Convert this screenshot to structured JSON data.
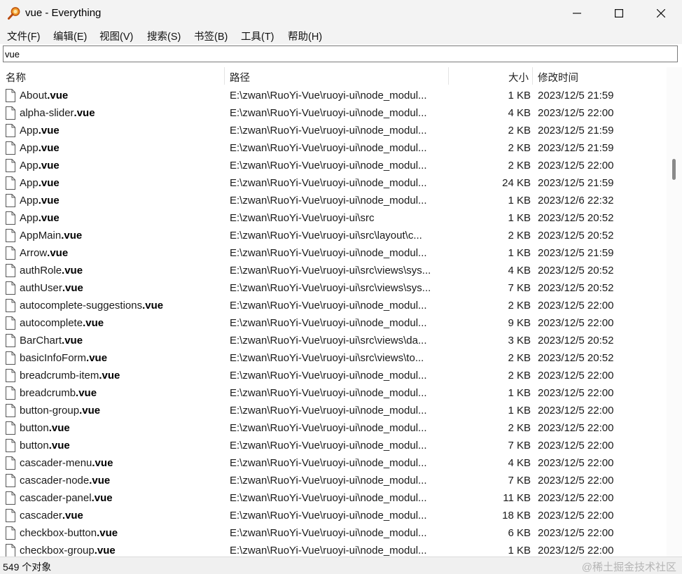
{
  "window": {
    "title": "vue - Everything",
    "minimize_icon": "minimize-icon",
    "maximize_icon": "maximize-icon",
    "close_icon": "close-icon"
  },
  "menu": [
    "文件(F)",
    "编辑(E)",
    "视图(V)",
    "搜索(S)",
    "书签(B)",
    "工具(T)",
    "帮助(H)"
  ],
  "search": {
    "value": "vue",
    "placeholder": ""
  },
  "columns": {
    "name": "名称",
    "path": "路径",
    "size": "大小",
    "modified": "修改时间"
  },
  "files": [
    {
      "base": "About",
      "ext": ".vue",
      "path": "E:\\zwan\\RuoYi-Vue\\ruoyi-ui\\node_modul...",
      "size": "1 KB",
      "date": "2023/12/5 21:59"
    },
    {
      "base": "alpha-slider",
      "ext": ".vue",
      "path": "E:\\zwan\\RuoYi-Vue\\ruoyi-ui\\node_modul...",
      "size": "4 KB",
      "date": "2023/12/5 22:00"
    },
    {
      "base": "App",
      "ext": ".vue",
      "path": "E:\\zwan\\RuoYi-Vue\\ruoyi-ui\\node_modul...",
      "size": "2 KB",
      "date": "2023/12/5 21:59"
    },
    {
      "base": "App",
      "ext": ".vue",
      "path": "E:\\zwan\\RuoYi-Vue\\ruoyi-ui\\node_modul...",
      "size": "2 KB",
      "date": "2023/12/5 21:59"
    },
    {
      "base": "App",
      "ext": ".vue",
      "path": "E:\\zwan\\RuoYi-Vue\\ruoyi-ui\\node_modul...",
      "size": "2 KB",
      "date": "2023/12/5 22:00"
    },
    {
      "base": "App",
      "ext": ".vue",
      "path": "E:\\zwan\\RuoYi-Vue\\ruoyi-ui\\node_modul...",
      "size": "24 KB",
      "date": "2023/12/5 21:59"
    },
    {
      "base": "App",
      "ext": ".vue",
      "path": "E:\\zwan\\RuoYi-Vue\\ruoyi-ui\\node_modul...",
      "size": "1 KB",
      "date": "2023/12/6 22:32"
    },
    {
      "base": "App",
      "ext": ".vue",
      "path": "E:\\zwan\\RuoYi-Vue\\ruoyi-ui\\src",
      "size": "1 KB",
      "date": "2023/12/5 20:52"
    },
    {
      "base": "AppMain",
      "ext": ".vue",
      "path": "E:\\zwan\\RuoYi-Vue\\ruoyi-ui\\src\\layout\\c...",
      "size": "2 KB",
      "date": "2023/12/5 20:52"
    },
    {
      "base": "Arrow",
      "ext": ".vue",
      "path": "E:\\zwan\\RuoYi-Vue\\ruoyi-ui\\node_modul...",
      "size": "1 KB",
      "date": "2023/12/5 21:59"
    },
    {
      "base": "authRole",
      "ext": ".vue",
      "path": "E:\\zwan\\RuoYi-Vue\\ruoyi-ui\\src\\views\\sys...",
      "size": "4 KB",
      "date": "2023/12/5 20:52"
    },
    {
      "base": "authUser",
      "ext": ".vue",
      "path": "E:\\zwan\\RuoYi-Vue\\ruoyi-ui\\src\\views\\sys...",
      "size": "7 KB",
      "date": "2023/12/5 20:52"
    },
    {
      "base": "autocomplete-suggestions",
      "ext": ".vue",
      "path": "E:\\zwan\\RuoYi-Vue\\ruoyi-ui\\node_modul...",
      "size": "2 KB",
      "date": "2023/12/5 22:00"
    },
    {
      "base": "autocomplete",
      "ext": ".vue",
      "path": "E:\\zwan\\RuoYi-Vue\\ruoyi-ui\\node_modul...",
      "size": "9 KB",
      "date": "2023/12/5 22:00"
    },
    {
      "base": "BarChart",
      "ext": ".vue",
      "path": "E:\\zwan\\RuoYi-Vue\\ruoyi-ui\\src\\views\\da...",
      "size": "3 KB",
      "date": "2023/12/5 20:52"
    },
    {
      "base": "basicInfoForm",
      "ext": ".vue",
      "path": "E:\\zwan\\RuoYi-Vue\\ruoyi-ui\\src\\views\\to...",
      "size": "2 KB",
      "date": "2023/12/5 20:52"
    },
    {
      "base": "breadcrumb-item",
      "ext": ".vue",
      "path": "E:\\zwan\\RuoYi-Vue\\ruoyi-ui\\node_modul...",
      "size": "2 KB",
      "date": "2023/12/5 22:00"
    },
    {
      "base": "breadcrumb",
      "ext": ".vue",
      "path": "E:\\zwan\\RuoYi-Vue\\ruoyi-ui\\node_modul...",
      "size": "1 KB",
      "date": "2023/12/5 22:00"
    },
    {
      "base": "button-group",
      "ext": ".vue",
      "path": "E:\\zwan\\RuoYi-Vue\\ruoyi-ui\\node_modul...",
      "size": "1 KB",
      "date": "2023/12/5 22:00"
    },
    {
      "base": "button",
      "ext": ".vue",
      "path": "E:\\zwan\\RuoYi-Vue\\ruoyi-ui\\node_modul...",
      "size": "2 KB",
      "date": "2023/12/5 22:00"
    },
    {
      "base": "button",
      "ext": ".vue",
      "path": "E:\\zwan\\RuoYi-Vue\\ruoyi-ui\\node_modul...",
      "size": "7 KB",
      "date": "2023/12/5 22:00"
    },
    {
      "base": "cascader-menu",
      "ext": ".vue",
      "path": "E:\\zwan\\RuoYi-Vue\\ruoyi-ui\\node_modul...",
      "size": "4 KB",
      "date": "2023/12/5 22:00"
    },
    {
      "base": "cascader-node",
      "ext": ".vue",
      "path": "E:\\zwan\\RuoYi-Vue\\ruoyi-ui\\node_modul...",
      "size": "7 KB",
      "date": "2023/12/5 22:00"
    },
    {
      "base": "cascader-panel",
      "ext": ".vue",
      "path": "E:\\zwan\\RuoYi-Vue\\ruoyi-ui\\node_modul...",
      "size": "11 KB",
      "date": "2023/12/5 22:00"
    },
    {
      "base": "cascader",
      "ext": ".vue",
      "path": "E:\\zwan\\RuoYi-Vue\\ruoyi-ui\\node_modul...",
      "size": "18 KB",
      "date": "2023/12/5 22:00"
    },
    {
      "base": "checkbox-button",
      "ext": ".vue",
      "path": "E:\\zwan\\RuoYi-Vue\\ruoyi-ui\\node_modul...",
      "size": "6 KB",
      "date": "2023/12/5 22:00"
    },
    {
      "base": "checkbox-group",
      "ext": ".vue",
      "path": "E:\\zwan\\RuoYi-Vue\\ruoyi-ui\\node_modul...",
      "size": "1 KB",
      "date": "2023/12/5 22:00"
    }
  ],
  "status": {
    "count": "549 个对象",
    "watermark": "@稀土掘金技术社区"
  },
  "scrollbar": {
    "position_fraction": 0.2
  },
  "colors": {
    "titlebar_bg": "#f3f3f3",
    "icon_orange": "#e8731c",
    "text": "#1a1a1a"
  }
}
